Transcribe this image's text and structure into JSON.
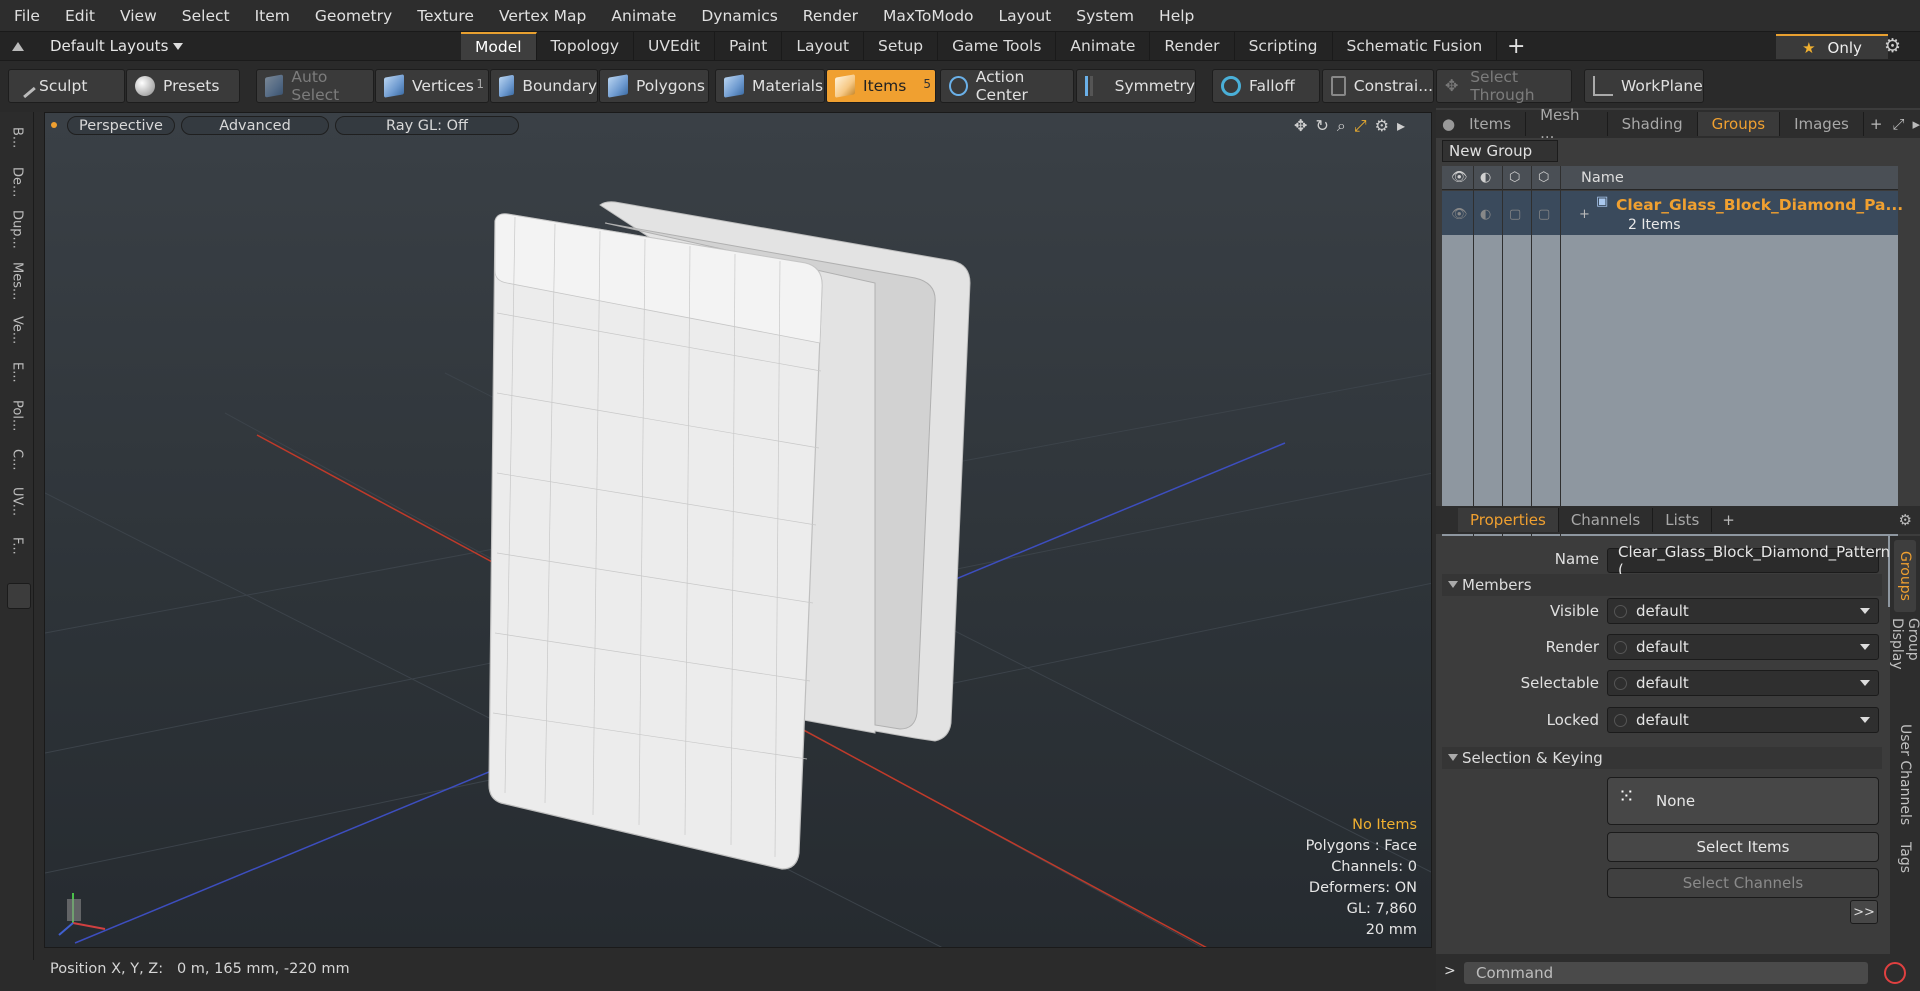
{
  "menu": [
    "File",
    "Edit",
    "View",
    "Select",
    "Item",
    "Geometry",
    "Texture",
    "Vertex Map",
    "Animate",
    "Dynamics",
    "Render",
    "MaxToModo",
    "Layout",
    "System",
    "Help"
  ],
  "layouts_label": "Default Layouts",
  "mode_tabs": [
    "Model",
    "Topology",
    "UVEdit",
    "Paint",
    "Layout",
    "Setup",
    "Game Tools",
    "Animate",
    "Render",
    "Scripting",
    "Schematic Fusion"
  ],
  "active_tab": "Model",
  "only_label": "Only",
  "toolbar": {
    "sculpt": "Sculpt",
    "presets": "Presets",
    "auto_select": "Auto Select",
    "vertices": "Vertices",
    "vertices_count": "1",
    "boundary": "Boundary",
    "polygons": "Polygons",
    "materials": "Materials",
    "items": "Items",
    "items_count": "5",
    "action_center": "Action Center",
    "symmetry": "Symmetry",
    "falloff": "Falloff",
    "constrain": "Constrai...",
    "select_through": "Select Through",
    "workplane": "WorkPlane"
  },
  "left_tabs": [
    "B...",
    "De...",
    "Dup...",
    "Mes...",
    "Ve...",
    "E...",
    "Pol...",
    "C...",
    "UV...",
    "F..."
  ],
  "viewport": {
    "perspective": "Perspective",
    "advanced": "Advanced",
    "raygl": "Ray GL: Off",
    "info": {
      "no_items": "No Items",
      "polygons": "Polygons : Face",
      "channels": "Channels: 0",
      "deformers": "Deformers: ON",
      "gl": "GL: 7,860",
      "size": "20 mm"
    }
  },
  "status": "Position X, Y, Z:   0 m, 165 mm, -220 mm",
  "right_tabs": [
    "Items",
    "Mesh ...",
    "Shading",
    "Groups",
    "Images"
  ],
  "right_active": "Groups",
  "new_group": "New Group",
  "name_header": "Name",
  "group": {
    "name": "Clear_Glass_Block_Diamond_Pa...",
    "count": "2 Items"
  },
  "prop_tabs": [
    "Properties",
    "Channels",
    "Lists"
  ],
  "prop_active": "Properties",
  "props": {
    "name_label": "Name",
    "name_value": "Clear_Glass_Block_Diamond_Pattern (",
    "members": "Members",
    "visible_label": "Visible",
    "render_label": "Render",
    "selectable_label": "Selectable",
    "locked_label": "Locked",
    "default": "default",
    "sel_keying": "Selection & Keying",
    "none": "None",
    "select_items": "Select Items",
    "select_channels": "Select Channels",
    "expand": ">>"
  },
  "side_tabs": [
    "Groups",
    "Group Display",
    "User Channels",
    "Tags"
  ],
  "command_placeholder": "Command"
}
